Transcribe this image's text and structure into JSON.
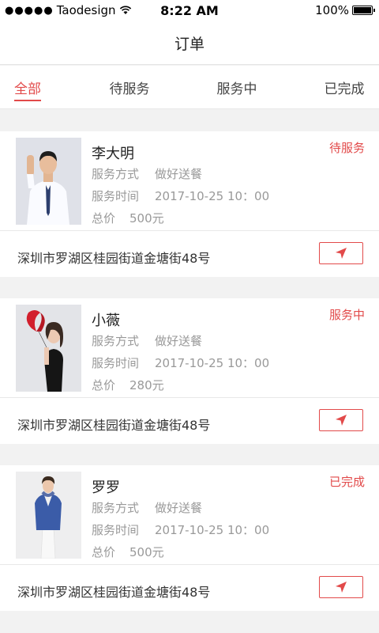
{
  "status_bar": {
    "signal_dots": "●●●●●",
    "carrier": "Taodesign",
    "wifi_icon": "wifi-icon",
    "time": "8:22 AM",
    "battery_percent": "100%"
  },
  "nav": {
    "title": "订单"
  },
  "tabs": [
    {
      "label": "全部",
      "active": true
    },
    {
      "label": "待服务",
      "active": false
    },
    {
      "label": "服务中",
      "active": false
    },
    {
      "label": "已完成",
      "active": false
    }
  ],
  "accent_color": "#e24a4a",
  "orders": [
    {
      "name": "李大明",
      "status": "待服务",
      "service_label": "服务方式",
      "service_value": "做好送餐",
      "time_label": "服务时间",
      "time_value": "2017-10-25  10：00",
      "price_label": "总价",
      "price_value": "500元",
      "address": "深圳市罗湖区桂园街道金塘街48号",
      "nav_icon": "navigation-arrow-icon"
    },
    {
      "name": "小薇",
      "status": "服务中",
      "service_label": "服务方式",
      "service_value": "做好送餐",
      "time_label": "服务时间",
      "time_value": "2017-10-25  10：00",
      "price_label": "总价",
      "price_value": "280元",
      "address": "深圳市罗湖区桂园街道金塘街48号",
      "nav_icon": "navigation-arrow-icon"
    },
    {
      "name": "罗罗",
      "status": "已完成",
      "service_label": "服务方式",
      "service_value": "做好送餐",
      "time_label": "服务时间",
      "time_value": "2017-10-25  10：00",
      "price_label": "总价",
      "price_value": "500元",
      "address": "深圳市罗湖区桂园街道金塘街48号",
      "nav_icon": "navigation-arrow-icon"
    }
  ]
}
